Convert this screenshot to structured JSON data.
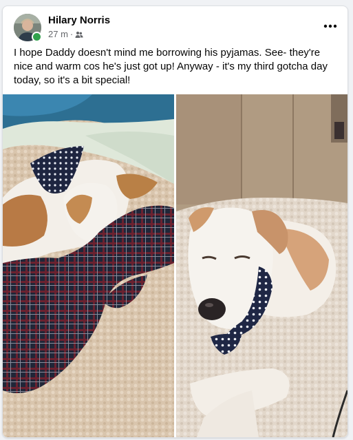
{
  "post": {
    "author": "Hilary Norris",
    "time": "27 m",
    "separator": "·",
    "audience_icon": "friends-icon",
    "more_icon": "more-options-icon",
    "text": "I hope Daddy doesn't mind me borrowing his pyjamas. See- they're nice and warm cos he's just got up! Anyway - it's my third gotcha day today, so it's a bit special!",
    "photos": [
      {
        "subject": "dog-sleeping-under-plaid-pyjamas"
      },
      {
        "subject": "dog-on-rug-with-polka-dot-bandana"
      }
    ]
  },
  "colors": {
    "online": "#31a24c",
    "text": "#050505",
    "meta": "#65676b"
  }
}
